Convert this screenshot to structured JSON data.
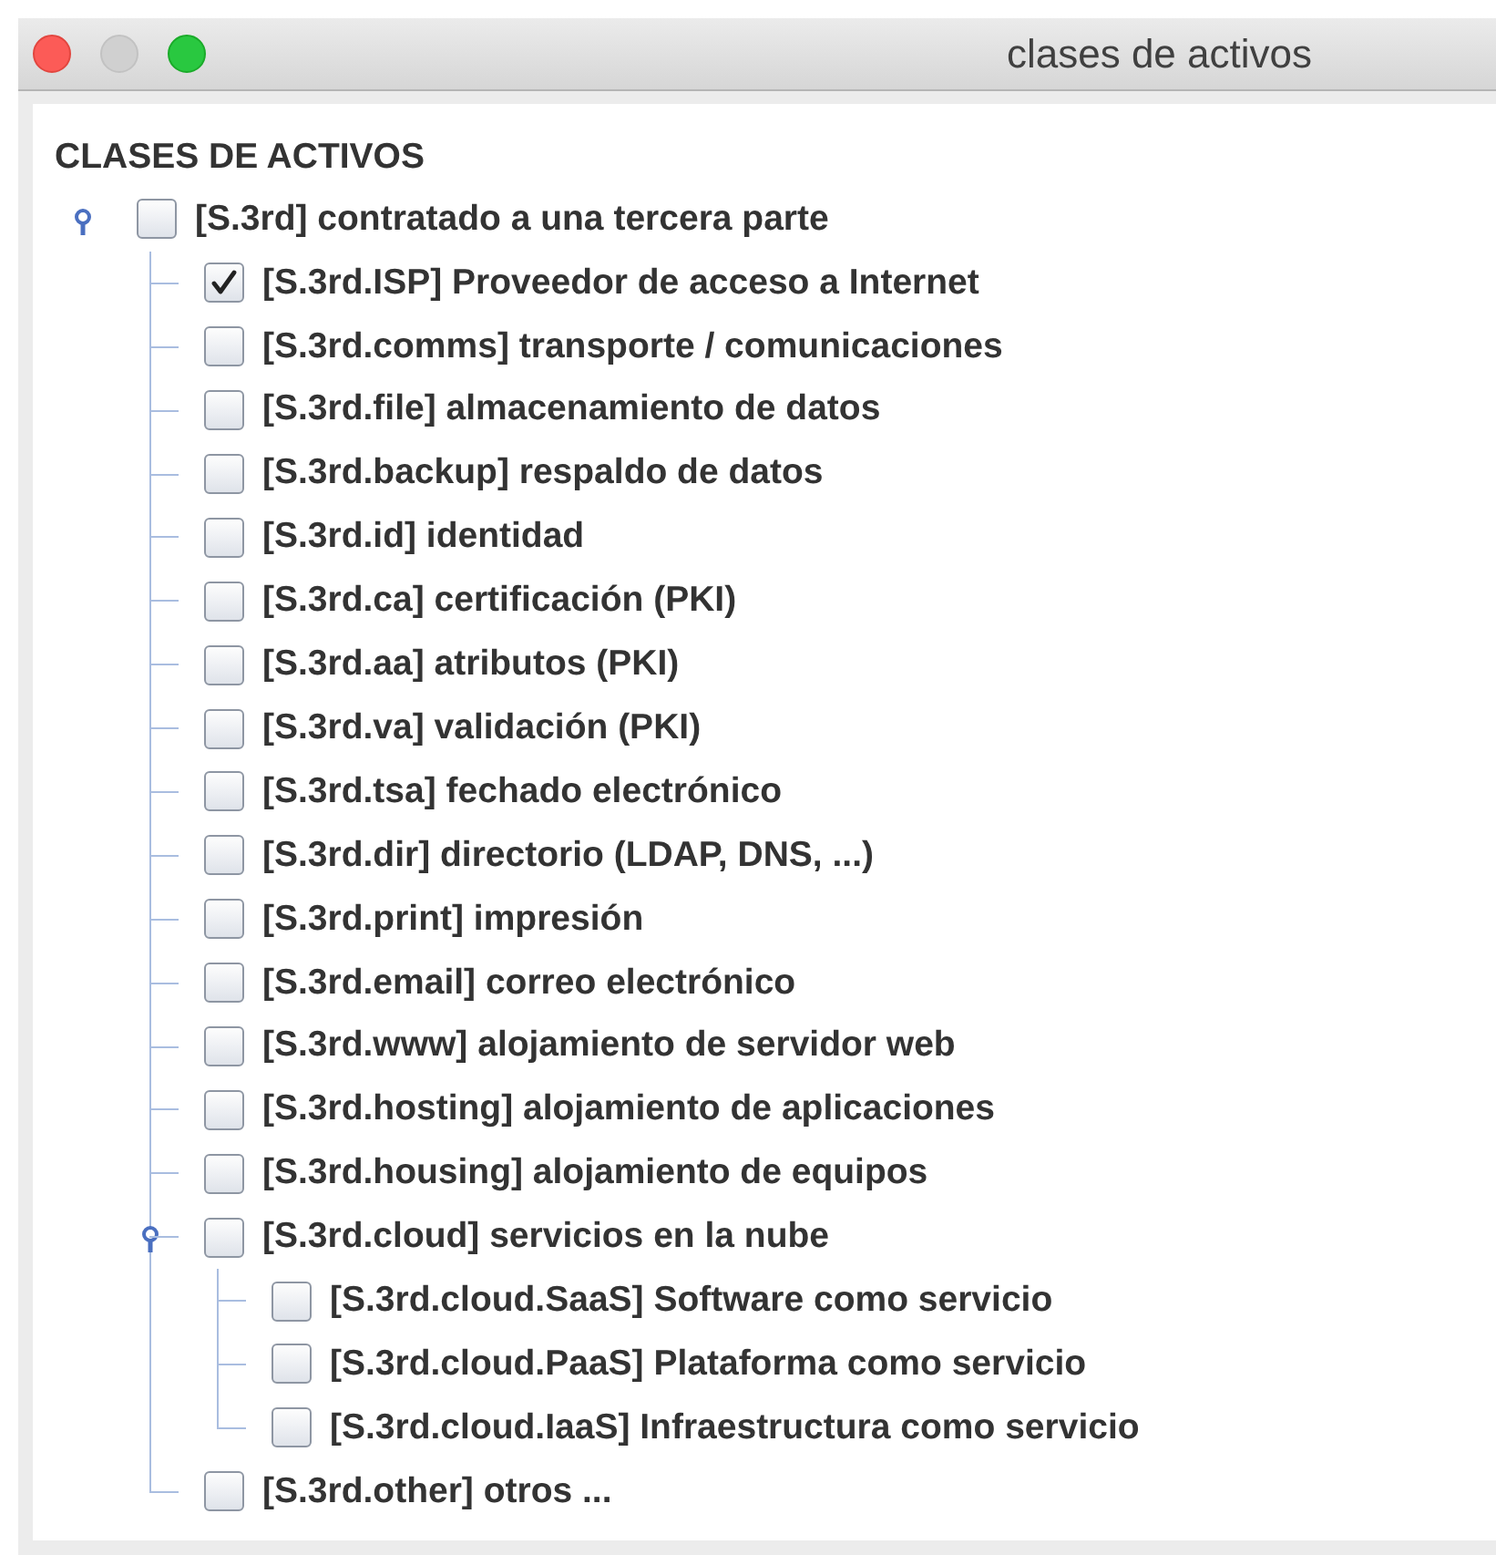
{
  "window": {
    "title": "clases de activos"
  },
  "tree": {
    "header": "CLASES DE ACTIVOS",
    "root": {
      "label": "[S.3rd] contratado a una tercera parte",
      "checked": false,
      "expanded": true,
      "children": [
        {
          "label": "[S.3rd.ISP] Proveedor de acceso a Internet",
          "checked": true
        },
        {
          "label": "[S.3rd.comms] transporte / comunicaciones",
          "checked": false
        },
        {
          "label": "[S.3rd.file] almacenamiento de datos",
          "checked": false
        },
        {
          "label": "[S.3rd.backup] respaldo de datos",
          "checked": false
        },
        {
          "label": "[S.3rd.id] identidad",
          "checked": false
        },
        {
          "label": "[S.3rd.ca] certificación (PKI)",
          "checked": false
        },
        {
          "label": "[S.3rd.aa] atributos (PKI)",
          "checked": false
        },
        {
          "label": "[S.3rd.va] validación (PKI)",
          "checked": false
        },
        {
          "label": "[S.3rd.tsa] fechado electrónico",
          "checked": false
        },
        {
          "label": "[S.3rd.dir] directorio (LDAP, DNS, ...)",
          "checked": false
        },
        {
          "label": "[S.3rd.print] impresión",
          "checked": false
        },
        {
          "label": "[S.3rd.email] correo electrónico",
          "checked": false
        },
        {
          "label": "[S.3rd.www] alojamiento de servidor web",
          "checked": false
        },
        {
          "label": "[S.3rd.hosting] alojamiento de aplicaciones",
          "checked": false
        },
        {
          "label": "[S.3rd.housing] alojamiento de equipos",
          "checked": false
        },
        {
          "label": "[S.3rd.cloud] servicios en la nube",
          "checked": false,
          "expanded": true,
          "children": [
            {
              "label": "[S.3rd.cloud.SaaS] Software como servicio",
              "checked": false
            },
            {
              "label": "[S.3rd.cloud.PaaS] Plataforma como servicio",
              "checked": false
            },
            {
              "label": "[S.3rd.cloud.IaaS] Infraestructura como servicio",
              "checked": false
            }
          ]
        },
        {
          "label": "[S.3rd.other] otros ...",
          "checked": false
        }
      ]
    }
  }
}
